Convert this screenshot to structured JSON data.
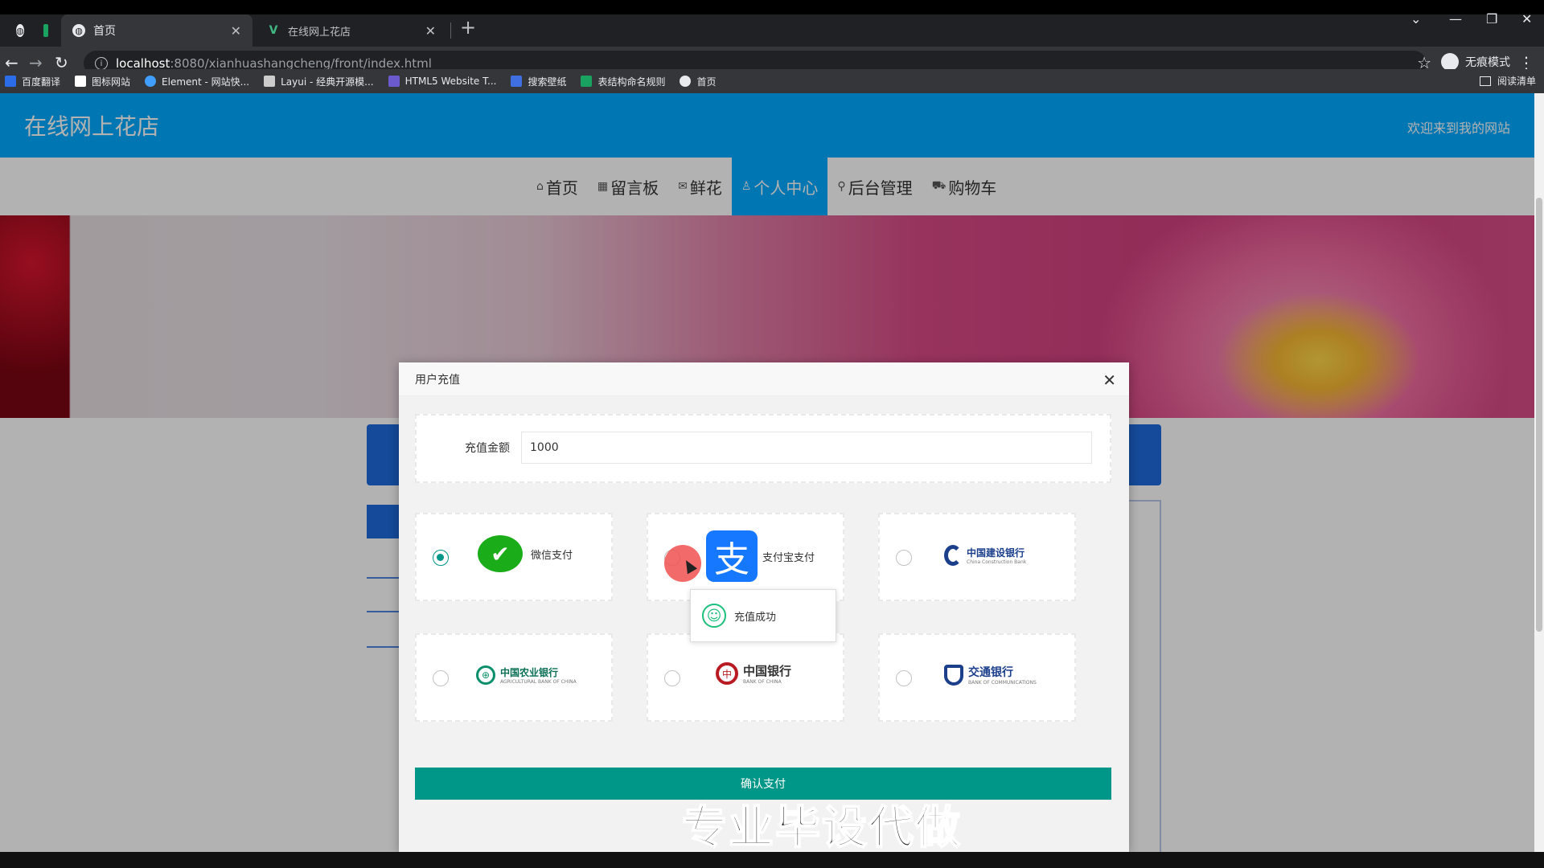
{
  "browser": {
    "tabs": [
      {
        "label": "首页",
        "active": true
      },
      {
        "label": "在线网上花店",
        "active": false
      }
    ],
    "url_host": "localhost",
    "url_path": ":8080/xianhuashangcheng/front/index.html",
    "incognito_label": "无痕模式",
    "bookmarks": [
      {
        "label": "百度翻译",
        "color": "#2b6de8"
      },
      {
        "label": "图标网站",
        "color": "#ffffff"
      },
      {
        "label": "Element - 网站快...",
        "color": "#409eff"
      },
      {
        "label": "Layui - 经典开源模...",
        "color": "#cccccc"
      },
      {
        "label": "HTML5 Website T...",
        "color": "#6a5acd"
      },
      {
        "label": "搜索壁纸",
        "color": "#3f6fe0"
      },
      {
        "label": "表结构命名规则",
        "color": "#1aa260"
      },
      {
        "label": "首页",
        "color": "#e8eaed"
      }
    ],
    "reading_list": "阅读清单"
  },
  "site": {
    "title": "在线网上花店",
    "welcome": "欢迎来到我的网站",
    "nav": [
      {
        "label": "首页",
        "icon": "home-icon",
        "glyph": "⌂",
        "active": false
      },
      {
        "label": "留言板",
        "icon": "message-board-icon",
        "glyph": "▦",
        "active": false
      },
      {
        "label": "鲜花",
        "icon": "mail-icon",
        "glyph": "✉",
        "active": false
      },
      {
        "label": "个人中心",
        "icon": "user-icon",
        "glyph": "♙",
        "active": true
      },
      {
        "label": "后台管理",
        "icon": "link-icon",
        "glyph": "⚲",
        "active": false
      },
      {
        "label": "购物车",
        "icon": "cart-icon",
        "glyph": "⛟",
        "active": false
      }
    ]
  },
  "dialog": {
    "title": "用户充值",
    "amount_label": "充值金额",
    "amount_value": "1000",
    "payments": [
      {
        "id": "wechat",
        "label": "微信支付",
        "checked": true
      },
      {
        "id": "alipay",
        "label": "支付宝支付",
        "checked": false
      },
      {
        "id": "ccb",
        "label": "中国建设银行",
        "sub": "China Construction Bank",
        "checked": false
      },
      {
        "id": "abc",
        "label": "中国农业银行",
        "sub": "AGRICULTURAL BANK OF CHINA",
        "checked": false
      },
      {
        "id": "boc",
        "label": "中国银行",
        "sub": "BANK OF CHINA",
        "checked": false
      },
      {
        "id": "bocom",
        "label": "交通银行",
        "sub": "BANK OF COMMUNICATIONS",
        "checked": false
      }
    ],
    "confirm_label": "确认支付",
    "toast": "充值成功"
  },
  "watermark": "专业毕设代做",
  "colors": {
    "header": "#00aaff",
    "confirm": "#009688",
    "wechat": "#1aad19",
    "alipay": "#1677ff"
  }
}
